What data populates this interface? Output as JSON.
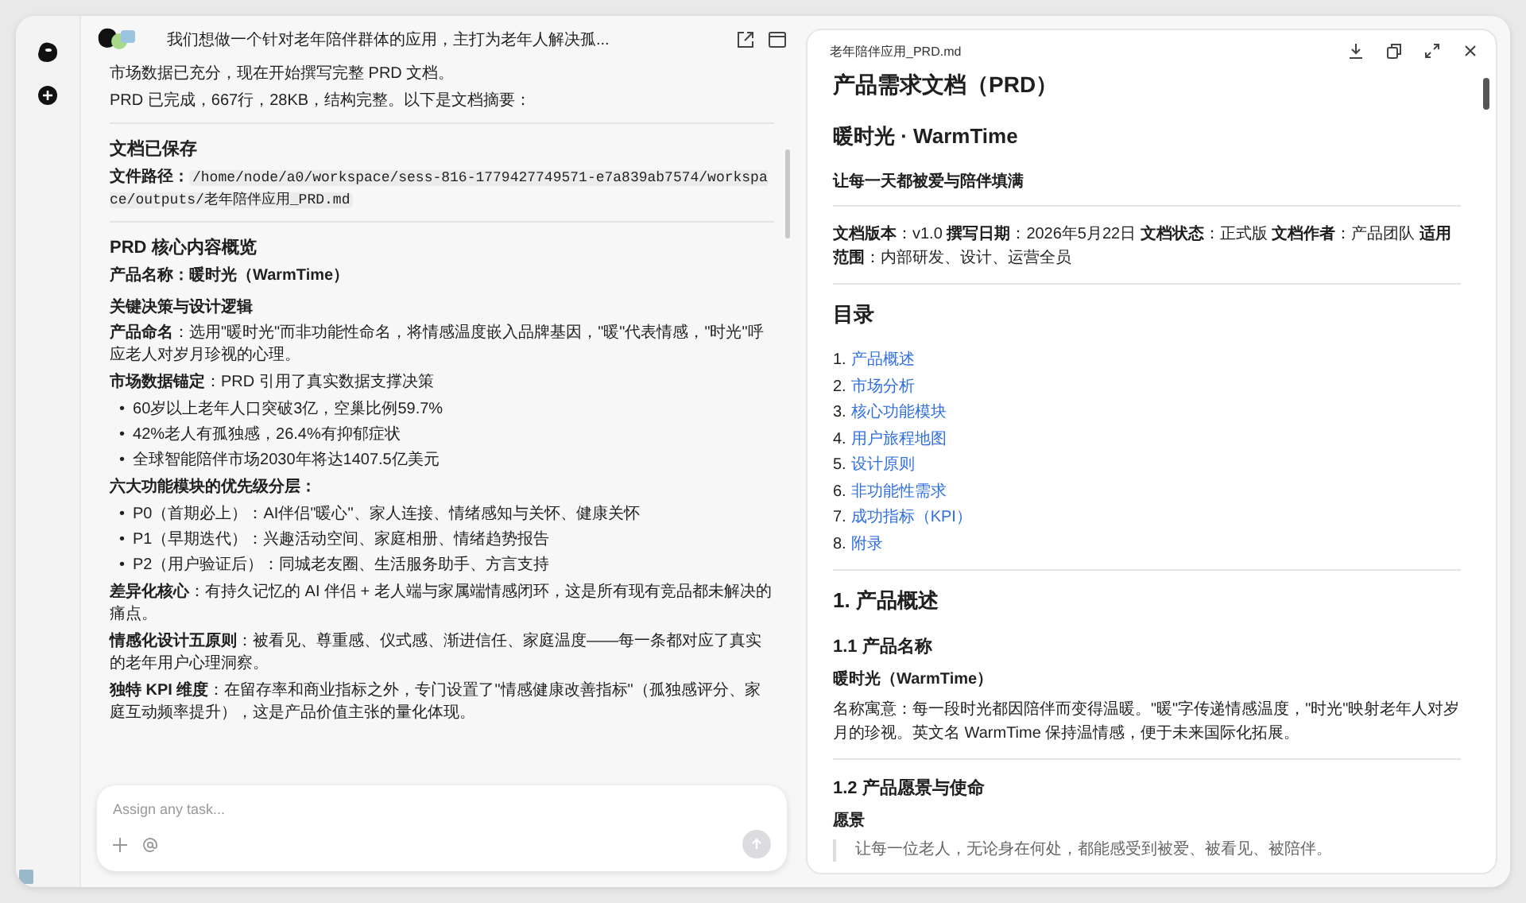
{
  "chat": {
    "title": "我们想做一个针对老年陪伴群体的应用，主打为老年人解决孤...",
    "blocks": [
      {
        "kind": "para",
        "text": "市场数据已充分，现在开始撰写完整 PRD 文档。"
      },
      {
        "kind": "para",
        "text": "PRD 已完成，667行，28KB，结构完整。以下是文档摘要："
      },
      {
        "kind": "rule"
      },
      {
        "kind": "heading",
        "text": "文档已保存"
      },
      {
        "kind": "path",
        "label": "文件路径：",
        "path": "/home/node/a0/workspace/sess-816-1779427749571-e7a839ab7574/workspace/outputs/老年陪伴应用_PRD.md"
      },
      {
        "kind": "rule"
      },
      {
        "kind": "heading",
        "text": "PRD 核心内容概览"
      },
      {
        "kind": "strong",
        "text": "产品名称：暖时光（WarmTime）"
      },
      {
        "kind": "subheading",
        "text": "关键决策与设计逻辑"
      },
      {
        "kind": "para",
        "text": "**产品命名**：选用\"暖时光\"而非功能性命名，将情感温度嵌入品牌基因，\"暖\"代表情感，\"时光\"呼应老人对岁月珍视的心理。"
      },
      {
        "kind": "para",
        "text": "**市场数据锚定**：PRD 引用了真实数据支撑决策"
      },
      {
        "kind": "list",
        "marker": "•",
        "items": [
          "60岁以上老年人口突破3亿，空巢比例59.7%",
          "42%老人有孤独感，26.4%有抑郁症状",
          "全球智能陪伴市场2030年将达1407.5亿美元"
        ]
      },
      {
        "kind": "strong",
        "text": "六大功能模块的优先级分层："
      },
      {
        "kind": "list",
        "marker": "•",
        "items": [
          "P0（首期必上）：AI伴侣\"暖心\"、家人连接、情绪感知与关怀、健康关怀",
          "P1（早期迭代）：兴趣活动空间、家庭相册、情绪趋势报告",
          "P2（用户验证后）：同城老友圈、生活服务助手、方言支持"
        ]
      },
      {
        "kind": "para",
        "text": "**差异化核心**：有持久记忆的 AI 伴侣 + 老人端与家属端情感闭环，这是所有现有竞品都未解决的痛点。"
      },
      {
        "kind": "para",
        "text": "**情感化设计五原则**：被看见、尊重感、仪式感、渐进信任、家庭温度——每一条都对应了真实的老年用户心理洞察。"
      },
      {
        "kind": "para",
        "text": "**独特 KPI 维度**：在留存率和商业指标之外，专门设置了\"情感健康改善指标\"（孤独感评分、家庭互动频率提升），这是产品价值主张的量化体现。"
      }
    ],
    "input": {
      "placeholder": "Assign any task..."
    },
    "send_disabled": true
  },
  "doc": {
    "filename": "老年陪伴应用_PRD.md",
    "blocks": [
      {
        "kind": "h1",
        "text": "产品需求文档（PRD）"
      },
      {
        "kind": "h2",
        "text": "暖时光 · WarmTime"
      },
      {
        "kind": "h4",
        "text": "让每一天都被爱与陪伴填满"
      },
      {
        "kind": "rule"
      },
      {
        "kind": "para",
        "text": "**文档版本**：v1.0 **撰写日期**：2026年5月22日 **文档状态**：正式版 **文档作者**：产品团队 **适用范围**：内部研发、设计、运营全员"
      },
      {
        "kind": "rule"
      },
      {
        "kind": "h2",
        "text": "目录"
      },
      {
        "kind": "toc",
        "items": [
          {
            "num": "1.",
            "text": "产品概述"
          },
          {
            "num": "2.",
            "text": "市场分析"
          },
          {
            "num": "3.",
            "text": "核心功能模块"
          },
          {
            "num": "4.",
            "text": "用户旅程地图"
          },
          {
            "num": "5.",
            "text": "设计原则"
          },
          {
            "num": "6.",
            "text": "非功能性需求"
          },
          {
            "num": "7.",
            "text": "成功指标（KPI）"
          },
          {
            "num": "8.",
            "text": "附录"
          }
        ]
      },
      {
        "kind": "rule"
      },
      {
        "kind": "h2",
        "text": "1. 产品概述"
      },
      {
        "kind": "h3",
        "text": "1.1 产品名称"
      },
      {
        "kind": "strong",
        "text": "暖时光（WarmTime）"
      },
      {
        "kind": "para",
        "text": "名称寓意：每一段时光都因陪伴而变得温暖。\"暖\"字传递情感温度，\"时光\"映射老年人对岁月的珍视。英文名 WarmTime 保持温情感，便于未来国际化拓展。"
      },
      {
        "kind": "rule"
      },
      {
        "kind": "h3",
        "text": "1.2 产品愿景与使命"
      },
      {
        "kind": "strong",
        "text": "愿景"
      },
      {
        "kind": "quote",
        "text": "让每一位老人，无论身在何处，都能感受到被爱、被看见、被陪伴。"
      }
    ]
  }
}
